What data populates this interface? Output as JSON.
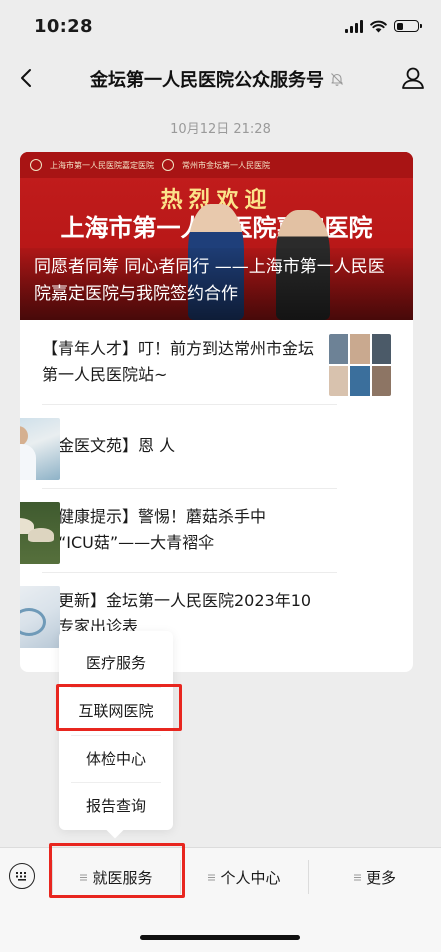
{
  "status_bar": {
    "time": "10:28",
    "battery_level": 0.3,
    "icons": [
      "signal-icon",
      "wifi-icon",
      "battery-icon"
    ]
  },
  "nav": {
    "title": "金坛第一人民医院公众服务号",
    "icons": [
      "back-arrow-icon",
      "muted-bell-icon",
      "profile-icon"
    ]
  },
  "message": {
    "timestamp": "10月12日 21:28"
  },
  "cover": {
    "welcome": "热烈欢迎",
    "headline": "上海市第一人民医院嘉定医院",
    "banner_left": "上海市第一人民医院嘉定医院",
    "banner_right": "常州市金坛第一人民医院",
    "title": "同愿者同筹 同心者同行 ——上海市第一人民医院嘉定医院与我院签约合作"
  },
  "articles": [
    {
      "title": "【青年人才】叮！前方到达常州市金坛第一人民医院站~",
      "thumb": "portrait-grid"
    },
    {
      "title": "【金医文苑】恩 人",
      "thumb": "doctor-with-patient"
    },
    {
      "title": "【健康提示】警惕！蘑菇杀手中的“ICU菇”——大青褶伞",
      "thumb": "mushrooms"
    },
    {
      "title": "【更新】金坛第一人民医院2023年10月专家出诊表",
      "thumb": "stethoscope"
    }
  ],
  "popup_menu": {
    "items": [
      {
        "label": "医疗服务"
      },
      {
        "label": "互联网医院"
      },
      {
        "label": "体检中心"
      },
      {
        "label": "报告查询"
      }
    ]
  },
  "menubar": {
    "keyboard_icon": "keyboard-icon",
    "tabs": [
      {
        "label": "就医服务"
      },
      {
        "label": "个人中心"
      },
      {
        "label": "更多"
      }
    ]
  },
  "colors": {
    "highlight": "#e8261f",
    "cover_red": "#c31d1d",
    "background": "#ededed"
  }
}
